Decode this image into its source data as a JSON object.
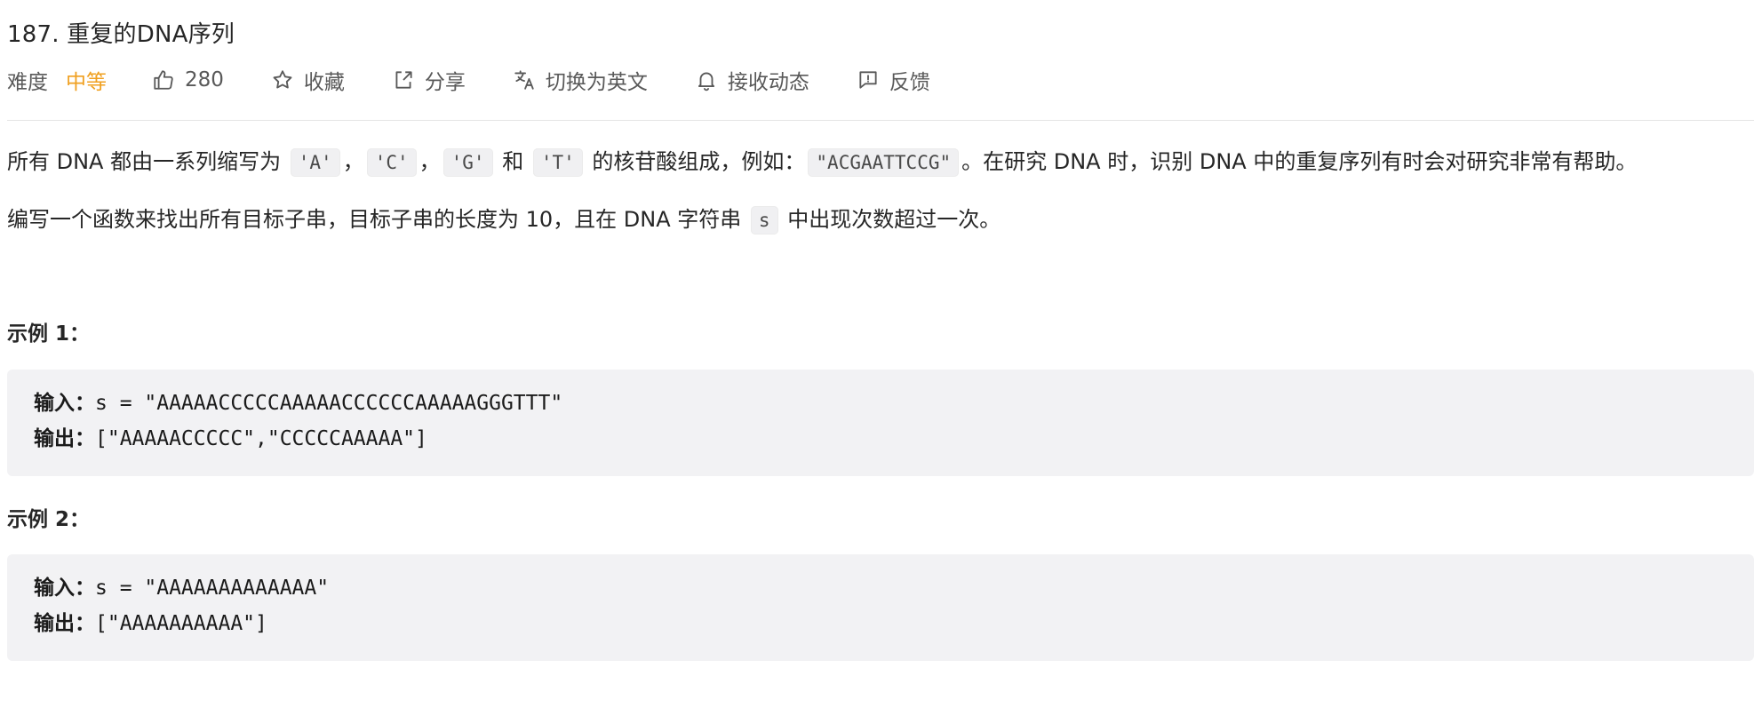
{
  "header": {
    "title": "187. 重复的DNA序列"
  },
  "meta": {
    "difficulty_label": "难度",
    "difficulty_value": "中等",
    "likes": "280",
    "favorite_label": "收藏",
    "share_label": "分享",
    "translate_label": "切换为英文",
    "subscribe_label": "接收动态",
    "feedback_label": "反馈"
  },
  "description": {
    "p1": {
      "t1": "所有 DNA 都由一系列缩写为 ",
      "c1": "'A'",
      "t2": "，",
      "c2": "'C'",
      "t3": "，",
      "c3": "'G'",
      "t4": " 和 ",
      "c4": "'T'",
      "t5": " 的核苷酸组成，例如：",
      "c5": "\"ACGAATTCCG\"",
      "t6": "。在研究 DNA 时，识别 DNA 中的重复序列有时会对研究非常有帮助。"
    },
    "p2": {
      "t1": "编写一个函数来找出所有目标子串，目标子串的长度为 10，且在 DNA 字符串 ",
      "c1": "s",
      "t2": " 中出现次数超过一次。"
    }
  },
  "examples": [
    {
      "heading": "示例 1：",
      "input_label": "输入：",
      "input_value": "s = \"AAAAACCCCCAAAAACCCCCCAAAAAGGGTTT\"",
      "output_label": "输出：",
      "output_value": "[\"AAAAACCCCC\",\"CCCCCAAAAA\"]"
    },
    {
      "heading": "示例 2：",
      "input_label": "输入：",
      "input_value": "s = \"AAAAAAAAAAAAA\"",
      "output_label": "输出：",
      "output_value": "[\"AAAAAAAAAA\"]"
    }
  ],
  "icons": {
    "like": "thumbs-up-icon",
    "favorite": "star-icon",
    "share": "share-icon",
    "translate": "translate-icon",
    "subscribe": "bell-icon",
    "feedback": "feedback-icon"
  },
  "colors": {
    "difficulty_medium": "#f0a020",
    "code_bg": "#f2f2f4"
  }
}
